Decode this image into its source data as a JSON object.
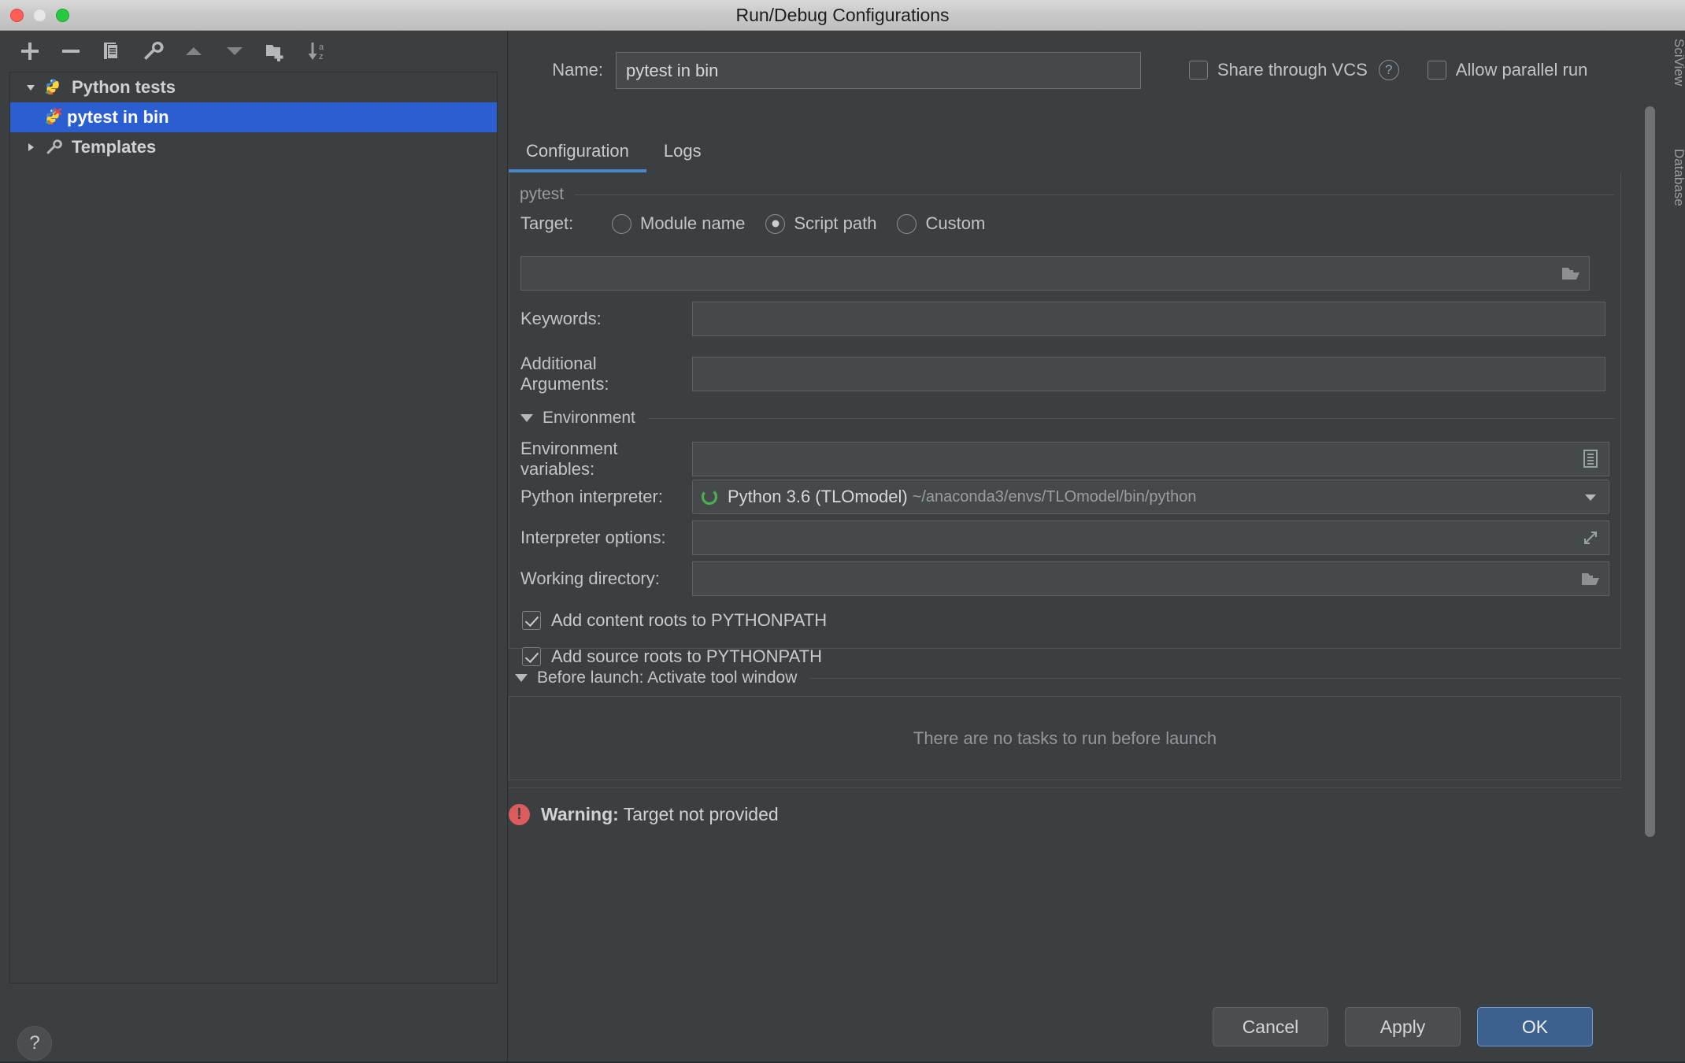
{
  "window": {
    "title": "Run/Debug Configurations",
    "traffic_lights": [
      "close-button",
      "minimize-button",
      "maximize-button"
    ]
  },
  "ide_background": {
    "labels": [
      "SciView",
      "Database"
    ]
  },
  "left_panel": {
    "toolbar": [
      {
        "name": "add-configuration-button",
        "icon": "plus-icon",
        "tooltip": "Add New Configuration"
      },
      {
        "name": "remove-configuration-button",
        "icon": "minus-icon",
        "tooltip": "Remove Configuration"
      },
      {
        "name": "copy-configuration-button",
        "icon": "copy-icon",
        "tooltip": "Copy Configuration"
      },
      {
        "name": "edit-templates-button",
        "icon": "wrench-icon",
        "tooltip": "Edit Templates"
      },
      {
        "name": "move-up-button",
        "icon": "triangle-up-icon",
        "tooltip": "Move Up"
      },
      {
        "name": "move-down-button",
        "icon": "triangle-down-icon",
        "tooltip": "Move Down"
      },
      {
        "name": "new-folder-button",
        "icon": "folder-plus-icon",
        "tooltip": "Create New Folder"
      },
      {
        "name": "sort-configurations-button",
        "icon": "sort-az-icon",
        "tooltip": "Sort Configurations"
      }
    ],
    "tree": [
      {
        "label": "Python tests",
        "level": 0,
        "expanded": true,
        "selected": false,
        "icon": "python-test-icon"
      },
      {
        "label": "pytest in bin",
        "level": 1,
        "expanded": null,
        "selected": true,
        "icon": "pytest-error-icon"
      },
      {
        "label": "Templates",
        "level": 0,
        "expanded": false,
        "selected": false,
        "icon": "wrench-icon"
      }
    ],
    "help_button": {
      "label": "?",
      "name": "help-button"
    }
  },
  "header": {
    "name_label": "Name:",
    "name_value": "pytest in bin",
    "share_vcs_label": "Share through VCS",
    "share_vcs_checked": false,
    "help_icon": "question-mark-icon",
    "allow_parallel_label": "Allow parallel run",
    "allow_parallel_checked": false
  },
  "tabs": [
    {
      "label": "Configuration",
      "active": true
    },
    {
      "label": "Logs",
      "active": false
    }
  ],
  "config": {
    "group_legend": "pytest",
    "target": {
      "label": "Target:",
      "options": [
        {
          "label": "Module name",
          "selected": false
        },
        {
          "label": "Script path",
          "selected": true
        },
        {
          "label": "Custom",
          "selected": false
        }
      ]
    },
    "target_path": {
      "value": "",
      "icon": "folder-open-icon"
    },
    "keywords": {
      "label": "Keywords:",
      "value": ""
    },
    "additional_arguments": {
      "label": "Additional Arguments:",
      "value": ""
    },
    "environment_section": {
      "title": "Environment",
      "expanded": true
    },
    "environment_variables": {
      "label": "Environment variables:",
      "value": "",
      "icon": "list-edit-icon"
    },
    "python_interpreter": {
      "label": "Python interpreter:",
      "value": "Python 3.6 (TLOmodel)",
      "path": "~/anaconda3/envs/TLOmodel/bin/python",
      "icon": "conda-python-icon",
      "dropdown_icon": "chevron-down-icon",
      "accent": "#4caf50"
    },
    "interpreter_options": {
      "label": "Interpreter options:",
      "value": "",
      "icon": "expand-diagonal-icon"
    },
    "working_directory": {
      "label": "Working directory:",
      "value": "",
      "icon": "folder-open-icon"
    },
    "checkboxes": [
      {
        "label": "Add content roots to PYTHONPATH",
        "checked": true
      },
      {
        "label": "Add source roots to PYTHONPATH",
        "checked": true
      }
    ]
  },
  "before_launch": {
    "title": "Before launch: Activate tool window",
    "expanded": true,
    "empty_text": "There are no tasks to run before launch"
  },
  "warning": {
    "icon": "error-exclamation-icon",
    "prefix": "Warning:",
    "message": "Target not provided",
    "color": "#db5c5c"
  },
  "footer_buttons": [
    {
      "label": "Cancel",
      "primary": false
    },
    {
      "label": "Apply",
      "primary": false
    },
    {
      "label": "OK",
      "primary": true
    }
  ],
  "colors": {
    "window_bg": "#3c3f41",
    "field_bg": "#45494a",
    "selection_blue": "#2b5ed0",
    "tab_accent": "#4a88c7",
    "primary_button": "#3c618e",
    "text": "#c2c5c7"
  }
}
